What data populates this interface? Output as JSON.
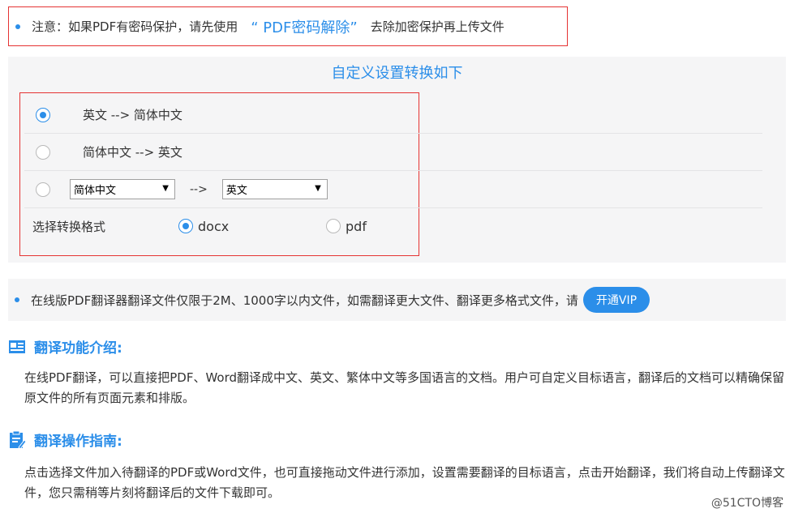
{
  "notice": {
    "prefix": "注意：如果PDF有密码保护，请先使用",
    "link": "“ PDF密码解除”",
    "suffix": "去除加密保护再上传文件"
  },
  "settings": {
    "title": "自定义设置转换如下",
    "options": [
      {
        "label": "英文 --> 简体中文",
        "checked": true
      },
      {
        "label": "简体中文 --> 英文",
        "checked": false
      }
    ],
    "custom": {
      "source_value": "简体中文",
      "arrow": "-->",
      "target_value": "英文"
    },
    "format": {
      "label": "选择转换格式",
      "options": [
        {
          "label": "docx",
          "checked": true
        },
        {
          "label": "pdf",
          "checked": false
        }
      ]
    }
  },
  "quota": {
    "text": "在线版PDF翻译器翻译文件仅限于2M、1000字以内文件，如需翻译更大文件、翻译更多格式文件，请",
    "button": "开通VIP"
  },
  "intro": {
    "title": "翻译功能介绍:",
    "body": "在线PDF翻译，可以直接把PDF、Word翻译成中文、英文、繁体中文等多国语言的文档。用户可自定义目标语言，翻译后的文档可以精确保留原文件的所有页面元素和排版。"
  },
  "guide": {
    "title": "翻译操作指南:",
    "body": "点击选择文件加入待翻译的PDF或Word文件，也可直接拖动文件进行添加，设置需要翻译的目标语言，点击开始翻译，我们将自动上传翻译文件，您只需稍等片刻将翻译后的文件下载即可。"
  },
  "watermark": "@51CTO博客",
  "colors": {
    "accent": "#2b8ee9",
    "highlight_border": "#e53333",
    "panel_bg": "#f5f5f6"
  },
  "icons": {
    "intro": "newspaper-icon",
    "guide": "clipboard-edit-icon"
  }
}
